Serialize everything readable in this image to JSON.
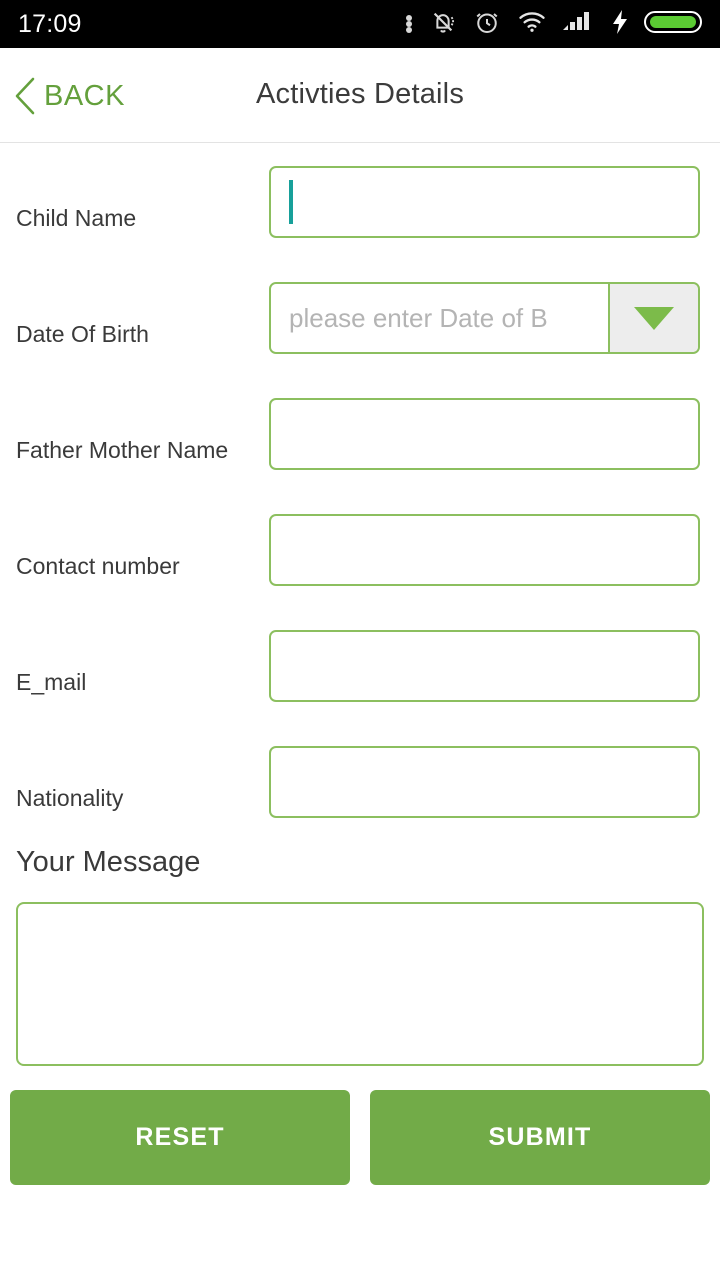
{
  "status_bar": {
    "time": "17:09",
    "icons": [
      "more-dots-icon",
      "notifications-silent-icon",
      "alarm-clock-icon",
      "wifi-icon",
      "cellular-signal-icon",
      "charging-bolt-icon",
      "battery-icon"
    ]
  },
  "header": {
    "back_label": "BACK",
    "title": "Activties Details"
  },
  "form": {
    "fields": [
      {
        "label": "Child Name",
        "value": "",
        "type": "text",
        "focused": true
      },
      {
        "label": "Date Of Birth",
        "value": "",
        "type": "select",
        "placeholder": "please enter Date of B"
      },
      {
        "label": "Father Mother Name",
        "value": "",
        "type": "text"
      },
      {
        "label": "Contact number",
        "value": "",
        "type": "text"
      },
      {
        "label": "E_mail",
        "value": "",
        "type": "text"
      },
      {
        "label": "Nationality",
        "value": "",
        "type": "text"
      }
    ],
    "message": {
      "heading": "Your Message",
      "value": ""
    }
  },
  "actions": {
    "reset_label": "RESET",
    "submit_label": "SUBMIT"
  },
  "colors": {
    "accent_green": "#72ab48",
    "border_green": "#8cbf5f",
    "back_green": "#64a03c",
    "caret_teal": "#17a09a",
    "placeholder_gray": "#b4b4b4",
    "status_bar_bg": "#000000",
    "battery_green": "#5bcb33"
  }
}
